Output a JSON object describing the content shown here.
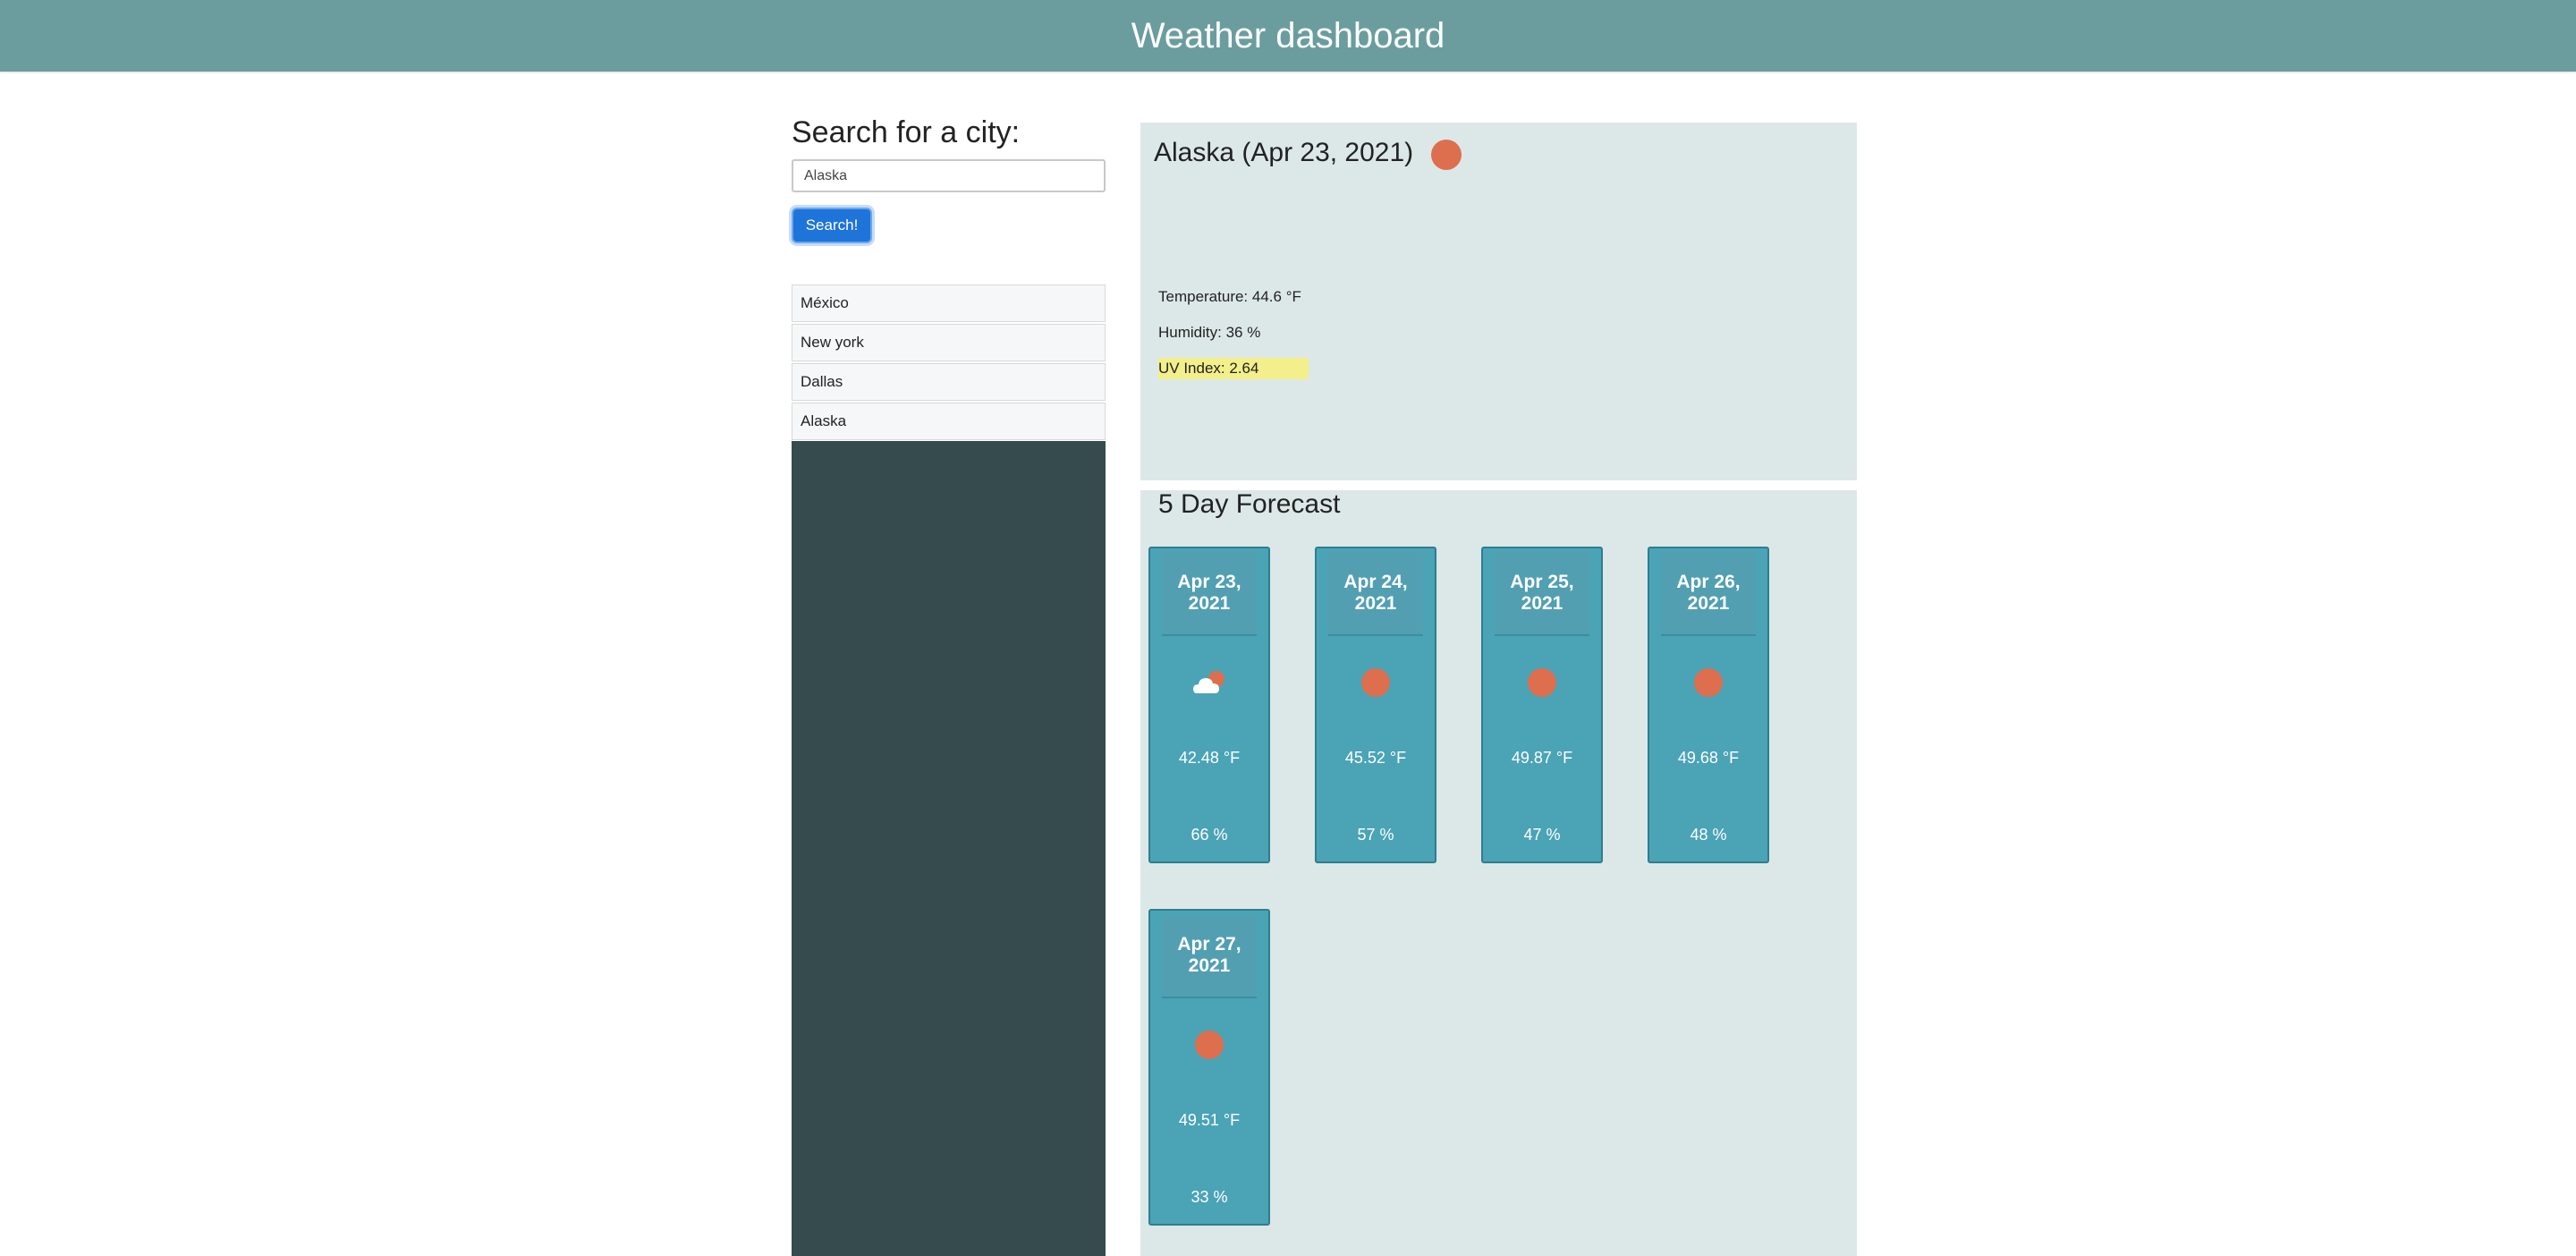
{
  "header": {
    "title": "Weather dashboard"
  },
  "search": {
    "title": "Search for a city:",
    "input_value": "Alaska",
    "button_label": "Search!"
  },
  "history": [
    "México",
    "New york",
    "Dallas",
    "Alaska"
  ],
  "current": {
    "title": "Alaska (Apr 23, 2021)",
    "icon": "sun-icon",
    "temperature": "Temperature: 44.6 °F",
    "humidity": "Humidity: 36 %",
    "uv_index": "UV Index: 2.64"
  },
  "forecast": {
    "title": "5 Day Forecast",
    "days": [
      {
        "date": "Apr 23, 2021",
        "icon": "cloud-sun-icon",
        "temp": "42.48 °F",
        "humidity": "66 %"
      },
      {
        "date": "Apr 24, 2021",
        "icon": "sun-icon",
        "temp": "45.52 °F",
        "humidity": "57 %"
      },
      {
        "date": "Apr 25, 2021",
        "icon": "sun-icon",
        "temp": "49.87 °F",
        "humidity": "47 %"
      },
      {
        "date": "Apr 26, 2021",
        "icon": "sun-icon",
        "temp": "49.68 °F",
        "humidity": "48 %"
      },
      {
        "date": "Apr 27, 2021",
        "icon": "sun-icon",
        "temp": "49.51 °F",
        "humidity": "33 %"
      }
    ]
  },
  "colors": {
    "header": "#6b9d9e",
    "sidebar_dark": "#354b4e",
    "panel": "#dce8e7",
    "card": "#4ba3b6",
    "sun": "#dd6f4e",
    "uv_highlight": "#f3ef8a",
    "button": "#1e74d8"
  }
}
